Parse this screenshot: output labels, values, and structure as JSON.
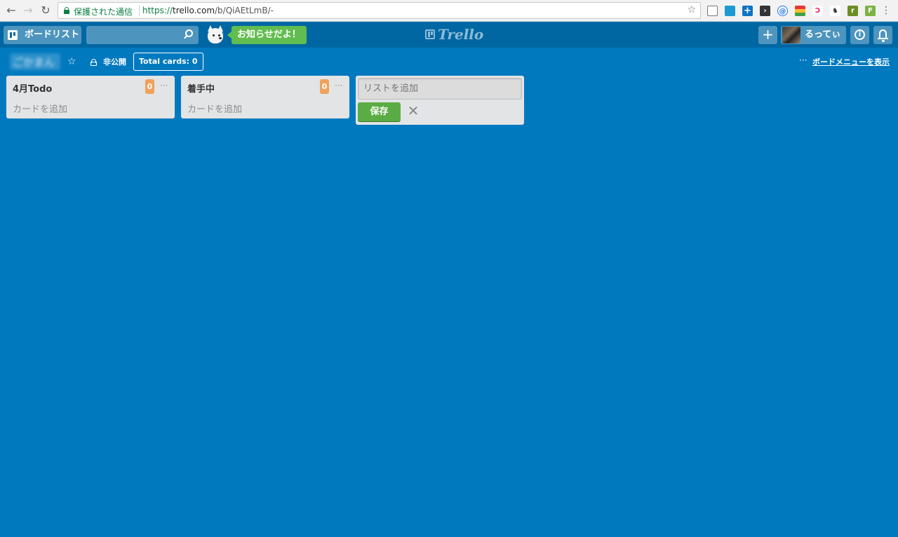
{
  "browser": {
    "secure_label": "保護された通信",
    "url_scheme": "https://",
    "url_host": "trello.com",
    "url_path": "/b/QiAEtLmB/-"
  },
  "header": {
    "boards_button": "ボードリスト",
    "search_placeholder": "",
    "news_button": "お知らせだよ！",
    "logo": "Trello",
    "user_name": "るってぃ",
    "colors": {
      "header_bg": "#0067a3",
      "news_green": "#61bd4f"
    }
  },
  "board": {
    "title": "ごかまん",
    "visibility": "非公開",
    "total_cards": "Total cards: 0",
    "menu_link": "ボードメニューを表示",
    "background": "#0079bf"
  },
  "lists": [
    {
      "title": "4月Todo",
      "count": "0",
      "add_card": "カードを追加"
    },
    {
      "title": "着手中",
      "count": "0",
      "add_card": "カードを追加"
    }
  ],
  "add_list": {
    "placeholder": "リストを追加",
    "save_label": "保存"
  }
}
